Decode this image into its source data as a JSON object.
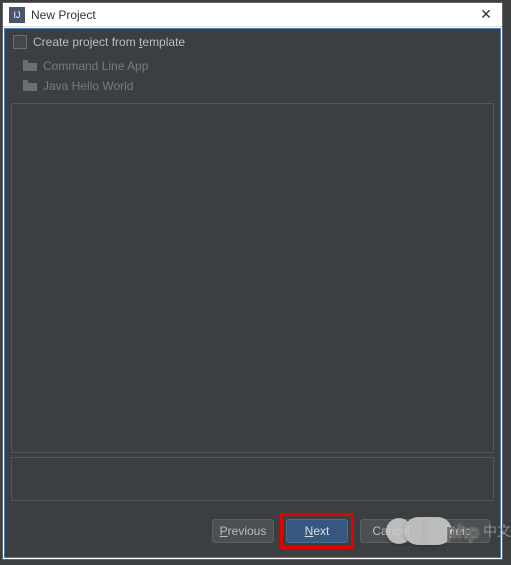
{
  "titlebar": {
    "icon_label": "IJ",
    "title": "New Project",
    "close_glyph": "✕"
  },
  "checkbox": {
    "prefix": "Create project from ",
    "underlined": "t",
    "suffix": "emplate"
  },
  "templates": [
    {
      "label": "Command Line App"
    },
    {
      "label": "Java Hello World"
    }
  ],
  "buttons": {
    "previous": {
      "underlined": "P",
      "rest": "revious"
    },
    "next": {
      "underlined": "N",
      "rest": "ext"
    },
    "cancel": {
      "label": "Cancel"
    },
    "help": {
      "label": "Help"
    }
  },
  "watermark": {
    "brand": "php",
    "cn": "中文"
  }
}
